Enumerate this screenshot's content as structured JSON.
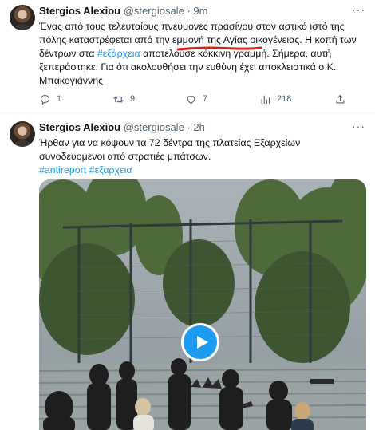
{
  "tweets": [
    {
      "author_name": "Stergios Alexiou",
      "handle": "@stergiosale",
      "separator": "·",
      "time": "9m",
      "more_label": "···",
      "text_part1": "Ένας από τους τελευταίους πνεύμονες πρασίνου στον αστικό ιστό της πόλης καταστρέφεται από την εμμονή της Αγίας οικογένειας. Η κοπή των δέντρων στα ",
      "hashtag": "#εξάρχεια",
      "text_part2": " αποτελούσε κόκκινη γραμμή. Σήμερα, αυτή ξεπεράστηκε. Για ότι ακολουθήσει την ευθύνη έχει αποκλειστικά ο Κ. Μπακογιάννης",
      "actions": {
        "replies": "1",
        "retweets": "9",
        "likes": "7",
        "views": "218"
      }
    },
    {
      "author_name": "Stergios Alexiou",
      "handle": "@stergiosale",
      "separator": "·",
      "time": "2h",
      "more_label": "···",
      "text": "Ήρθαν για να κόψουν τα 72 δέντρα της πλατείας Εξαρχείων συνοδευομενοι από στρατιές μπάτσων.",
      "hashtag1": "#antireport",
      "hashtag2": "#εξαρχεια"
    }
  ],
  "colors": {
    "link": "#1d9bf0",
    "secondary_text": "#536471",
    "annotation_red": "#e0201b"
  },
  "icons": [
    "reply-icon",
    "retweet-icon",
    "like-icon",
    "views-icon",
    "share-icon",
    "play-icon"
  ]
}
